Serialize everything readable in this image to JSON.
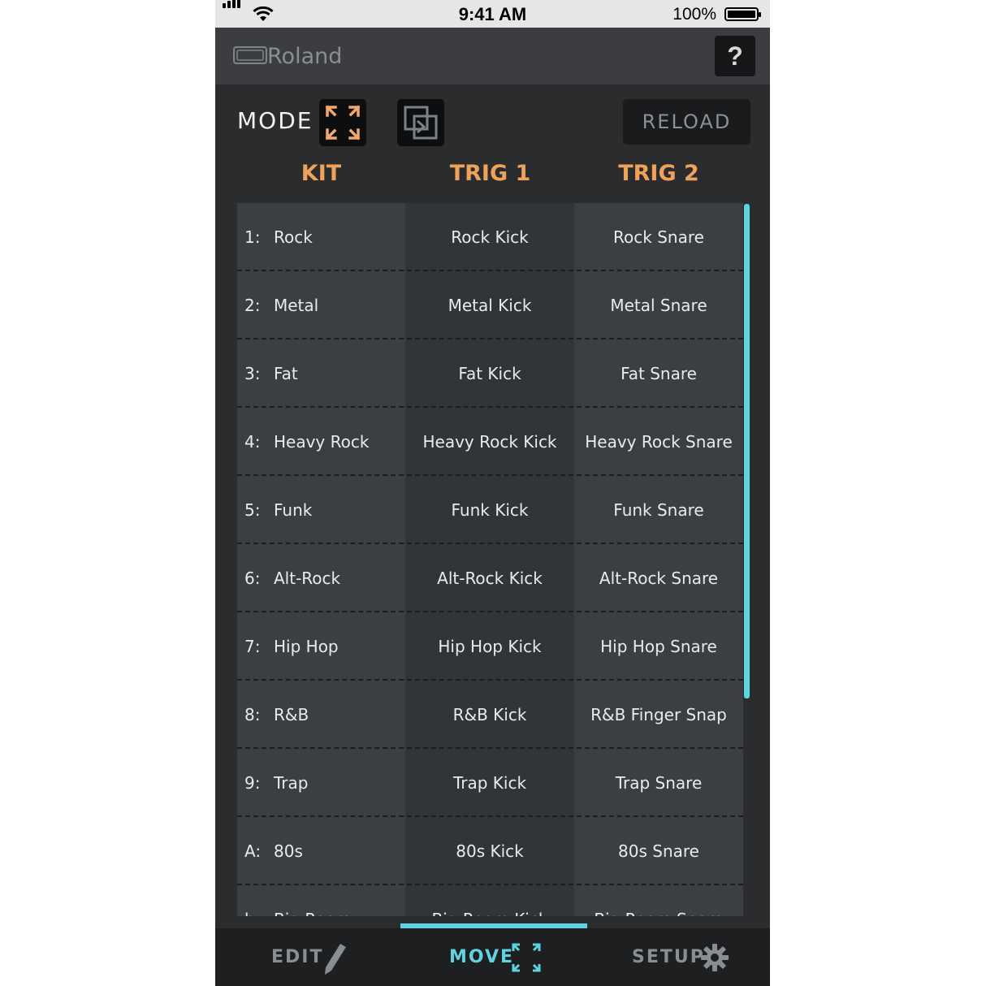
{
  "status_bar": {
    "time": "9:41 AM",
    "battery": "100%"
  },
  "header": {
    "brand": "Roland",
    "help_label": "?"
  },
  "mode": {
    "label": "MODE",
    "reload_label": "RELOAD"
  },
  "columns": {
    "kit": "KIT",
    "trig1": "TRIG 1",
    "trig2": "TRIG 2"
  },
  "rows": [
    {
      "num": "1:",
      "kit": "Rock",
      "trig1": "Rock Kick",
      "trig2": "Rock Snare"
    },
    {
      "num": "2:",
      "kit": "Metal",
      "trig1": "Metal Kick",
      "trig2": "Metal Snare"
    },
    {
      "num": "3:",
      "kit": "Fat",
      "trig1": "Fat Kick",
      "trig2": "Fat Snare"
    },
    {
      "num": "4:",
      "kit": "Heavy Rock",
      "trig1": "Heavy Rock Kick",
      "trig2": "Heavy Rock Snare"
    },
    {
      "num": "5:",
      "kit": "Funk",
      "trig1": "Funk Kick",
      "trig2": "Funk Snare"
    },
    {
      "num": "6:",
      "kit": "Alt-Rock",
      "trig1": "Alt-Rock Kick",
      "trig2": "Alt-Rock Snare"
    },
    {
      "num": "7:",
      "kit": "Hip Hop",
      "trig1": "Hip Hop Kick",
      "trig2": "Hip Hop Snare"
    },
    {
      "num": "8:",
      "kit": "R&B",
      "trig1": "R&B Kick",
      "trig2": "R&B Finger Snap"
    },
    {
      "num": "9:",
      "kit": "Trap",
      "trig1": "Trap Kick",
      "trig2": "Trap Snare"
    },
    {
      "num": "A:",
      "kit": "80s",
      "trig1": "80s Kick",
      "trig2": "80s Snare"
    },
    {
      "num": "b:",
      "kit": "Big Room",
      "trig1": "Big Room Kick",
      "trig2": "Big Room Snare"
    }
  ],
  "nav": {
    "edit": {
      "label": "EDIT",
      "icon": "pencil-icon",
      "color": "#8a8e92"
    },
    "move": {
      "label": "MOVE",
      "icon": "move-arrows-icon",
      "color": "#5fd3df"
    },
    "setup": {
      "label": "SETUP",
      "icon": "gear-icon",
      "color": "#8a8e92"
    }
  },
  "colors": {
    "accent": "#5fd3df",
    "header_orange": "#f0a25a",
    "mode_icon_orange": "#f5a66a"
  }
}
